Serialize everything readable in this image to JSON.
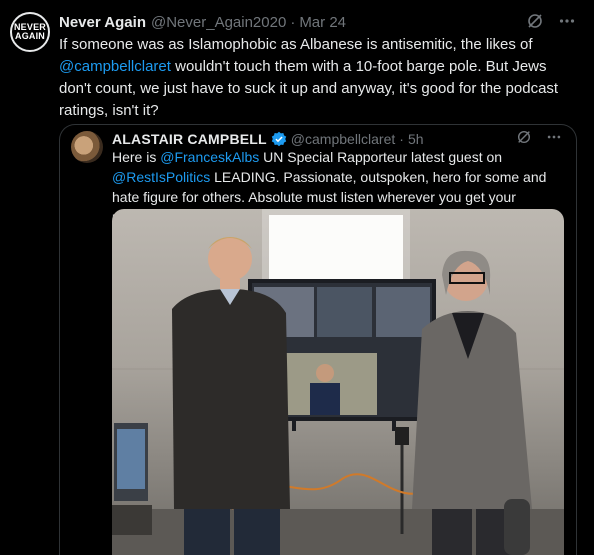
{
  "tweet": {
    "author_name": "Never Again",
    "author_handle": "@Never_Again2020",
    "dot": "·",
    "date": "Mar 24",
    "avatar_line1": "NEVER",
    "avatar_line2": "AGAIN",
    "text_part1": "If someone was as Islamophobic as Albanese is antisemitic, the likes of ",
    "mention": "@campbellclaret",
    "text_part2": " wouldn't touch them with a 10-foot barge pole. But Jews don't count, we just have to suck it up and anyway, it's good for the podcast ratings, isn't it?",
    "grok_icon": "grok-icon",
    "more_icon": "more-icon"
  },
  "quote": {
    "author_name": "ALASTAIR CAMPBELL",
    "author_handle": "@campbellclaret",
    "dot": "·",
    "time": "5h",
    "verified_icon": "verified-badge-icon",
    "text_part1": "Here is ",
    "mention1": "@FranceskAlbs",
    "text_part2": " UN Special Rapporteur latest guest on ",
    "mention2": "@RestIsPolitics",
    "text_part3": " LEADING. Passionate, outspoken, hero for some and hate figure for others. Absolute must listen wherever you get your podcasts.",
    "photo_icon": "podcast-studio-photo"
  },
  "colors": {
    "background": "#000000",
    "text": "#e7e9ea",
    "muted": "#71767b",
    "accent": "#1d9bf0",
    "border": "#2f3336"
  }
}
